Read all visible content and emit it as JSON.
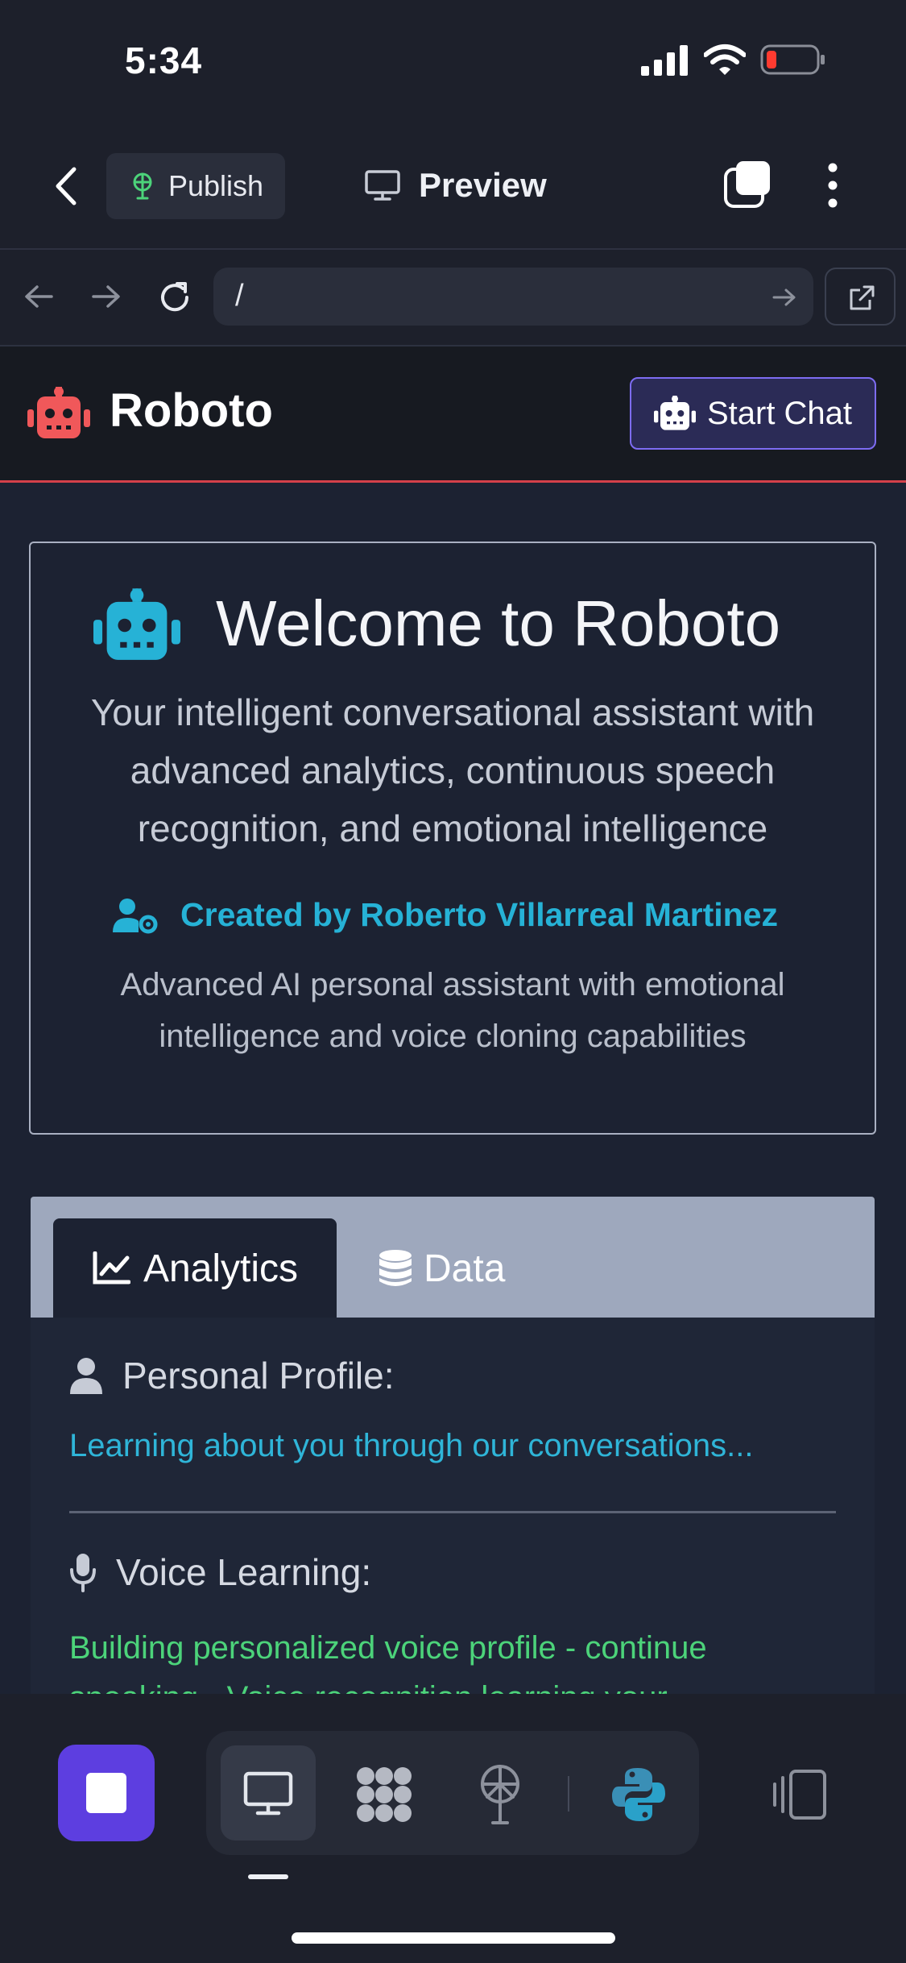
{
  "status_bar": {
    "time": "5:34"
  },
  "replit_bar": {
    "publish_label": "Publish",
    "preview_label": "Preview"
  },
  "url_bar": {
    "path": "/"
  },
  "app_header": {
    "brand": "Roboto",
    "start_chat_label": "Start Chat"
  },
  "hero": {
    "title": "Welcome to Roboto",
    "subtitle": "Your intelligent conversational assistant with advanced analytics, continuous speech recognition, and emotional intelligence",
    "creator": "Created by Roberto Villarreal Martinez",
    "creator_description": "Advanced AI personal assistant with emotional intelligence and voice cloning capabilities"
  },
  "tabs": [
    {
      "label": "Analytics",
      "active": true
    },
    {
      "label": "Data",
      "active": false
    }
  ],
  "analytics": {
    "personal_profile_title": "Personal Profile:",
    "personal_profile_text": "Learning about you through our conversations...",
    "voice_learning_title": "Voice Learning:",
    "voice_learning_text": "Building personalized voice profile - continue speaking - Voice recognition learning your"
  },
  "colors": {
    "brand_robot": "#f0585a",
    "accent_cyan": "#26b2d6",
    "accent_green": "#4cd37a",
    "accent_purple": "#5d3ee0",
    "header_border": "#d4404a"
  },
  "icons": {
    "back": "chevron-left-icon",
    "publish": "satellite-icon",
    "preview": "monitor-icon",
    "tabs": "tabs-icon",
    "menu": "kebab-menu-icon",
    "nav_back": "arrow-left-icon",
    "nav_forward": "arrow-right-icon",
    "reload": "reload-icon",
    "go": "arrow-right-small-icon",
    "open_external": "external-link-icon",
    "robot": "robot-icon",
    "user_gear": "user-gear-icon",
    "chart": "chart-line-icon",
    "database": "database-icon",
    "user": "user-icon",
    "microphone": "microphone-icon",
    "stop": "stop-icon",
    "python": "python-icon",
    "devices": "devices-icon"
  }
}
